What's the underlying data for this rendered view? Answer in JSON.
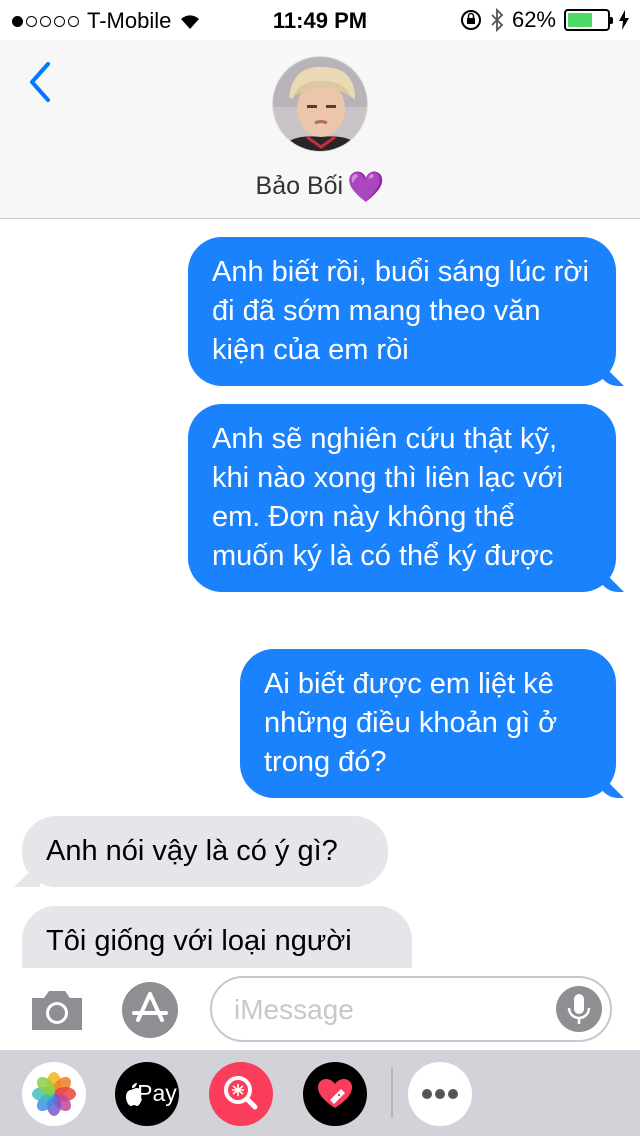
{
  "status_bar": {
    "signal_bars_filled": 1,
    "signal_bars_total": 5,
    "carrier": "T-Mobile",
    "time": "11:49 PM",
    "battery_percent": "62%",
    "battery_level": 0.62,
    "battery_color": "#4cd964"
  },
  "header": {
    "back_icon": "chevron-left-icon",
    "contact_name": "Bảo Bối",
    "contact_emoji": "💜"
  },
  "messages": [
    {
      "direction": "outgoing",
      "text": "Anh biết rồi, buổi sáng lúc rời đi đã sớm mang theo văn kiện của em rồi"
    },
    {
      "direction": "outgoing",
      "text": "Anh sẽ nghiên cứu thật kỹ, khi nào xong thì liên lạc với em. Đơn này không thể muốn ký là có thể ký được"
    },
    {
      "direction": "outgoing",
      "text": "Ai biết được em liệt kê những điều khoản gì ở trong đó?"
    },
    {
      "direction": "incoming",
      "text": "Anh nói vậy là có ý gì?"
    },
    {
      "direction": "incoming",
      "text": "Tôi giống với loại người"
    }
  ],
  "input_bar": {
    "placeholder": "iMessage",
    "camera_icon": "camera-icon",
    "appstore_icon": "app-store-icon",
    "mic_icon": "microphone-icon"
  },
  "app_drawer": {
    "apps": [
      {
        "name": "photos-app-icon"
      },
      {
        "name": "apple-pay-app-icon",
        "label": "Pay"
      },
      {
        "name": "search-images-app-icon"
      },
      {
        "name": "digital-touch-app-icon"
      },
      {
        "name": "more-apps-icon"
      }
    ]
  },
  "colors": {
    "outgoing_bubble": "#1982fc",
    "incoming_bubble": "#e5e5ea",
    "accent": "#007aff",
    "heart": "#a44be0"
  }
}
